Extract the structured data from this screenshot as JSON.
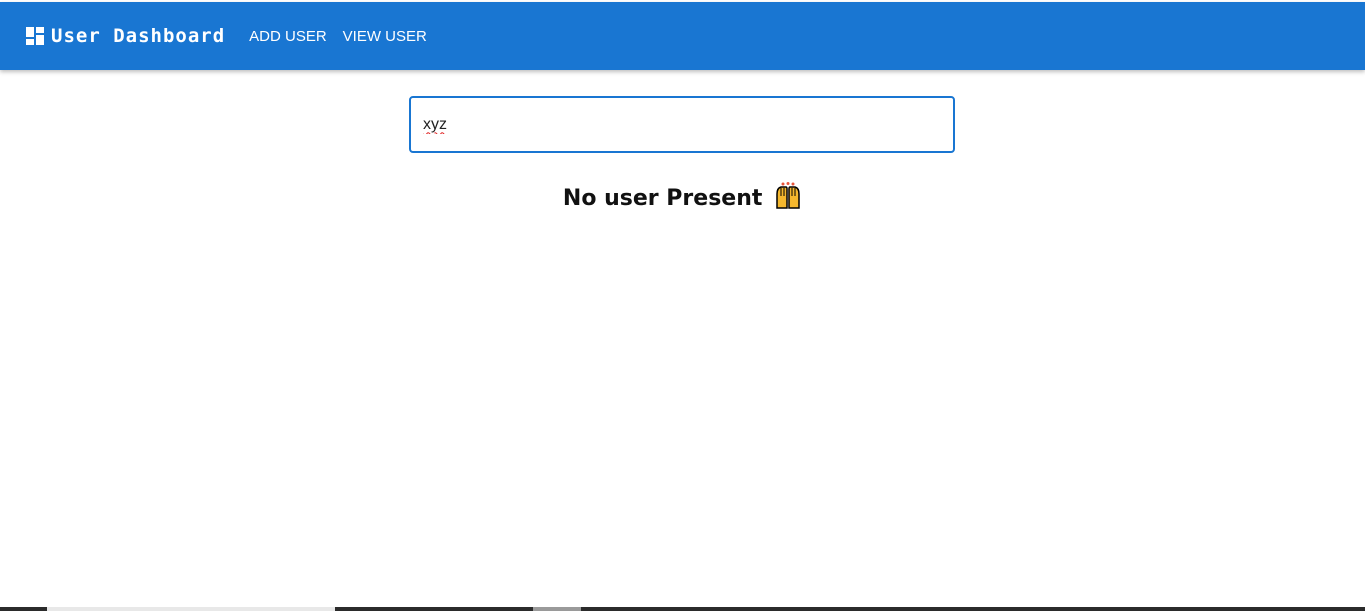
{
  "header": {
    "brand": "User Dashboard",
    "icon": "dashboard-icon",
    "nav": [
      {
        "label": "ADD USER"
      },
      {
        "label": "VIEW USER"
      }
    ],
    "color": "#1976d2"
  },
  "search": {
    "value": "xyz"
  },
  "message": {
    "text": "No user Present",
    "emoji_icon": "raising-hands-icon"
  }
}
